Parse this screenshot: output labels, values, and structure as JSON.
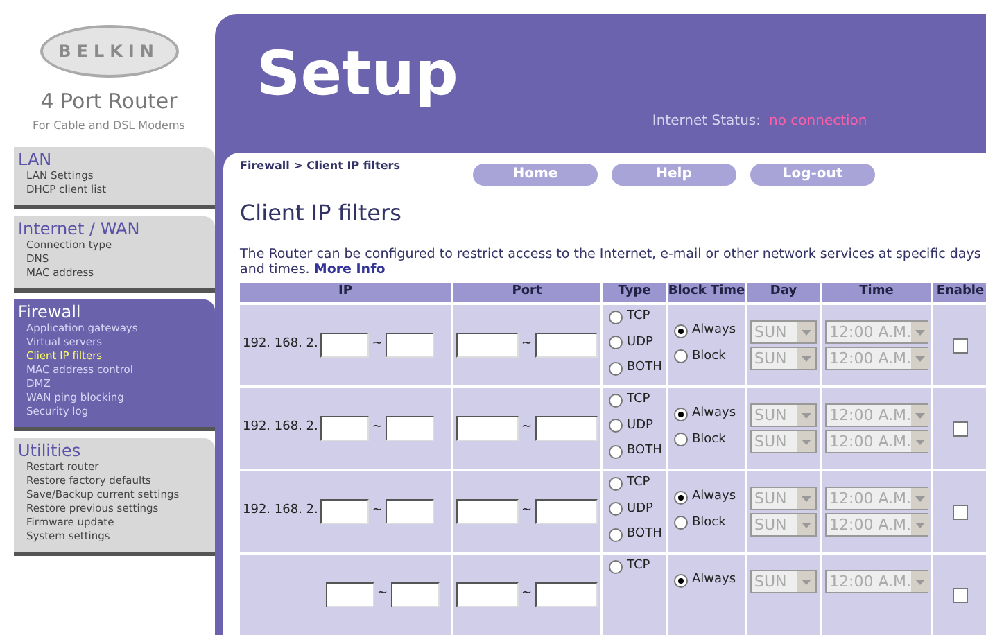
{
  "logo": {
    "brand": "BELKIN",
    "product": "4 Port Router",
    "tagline": "For Cable and DSL Modems"
  },
  "sidebar": {
    "sections": [
      {
        "title": "LAN",
        "selected": false,
        "items": [
          {
            "label": "LAN Settings",
            "selected": false
          },
          {
            "label": "DHCP client list",
            "selected": false
          }
        ]
      },
      {
        "title": "Internet / WAN",
        "selected": false,
        "items": [
          {
            "label": "Connection type",
            "selected": false
          },
          {
            "label": "DNS",
            "selected": false
          },
          {
            "label": "MAC address",
            "selected": false
          }
        ]
      },
      {
        "title": "Firewall",
        "selected": true,
        "items": [
          {
            "label": "Application gateways",
            "selected": false
          },
          {
            "label": "Virtual servers",
            "selected": false
          },
          {
            "label": "Client IP filters",
            "selected": true
          },
          {
            "label": "MAC address control",
            "selected": false
          },
          {
            "label": "DMZ",
            "selected": false
          },
          {
            "label": "WAN ping blocking",
            "selected": false
          },
          {
            "label": "Security log",
            "selected": false
          }
        ]
      },
      {
        "title": "Utilities",
        "selected": false,
        "items": [
          {
            "label": "Restart router",
            "selected": false
          },
          {
            "label": "Restore factory defaults",
            "selected": false
          },
          {
            "label": "Save/Backup current settings",
            "selected": false
          },
          {
            "label": "Restore previous settings",
            "selected": false
          },
          {
            "label": "Firmware update",
            "selected": false
          },
          {
            "label": "System settings",
            "selected": false
          }
        ]
      }
    ]
  },
  "header": {
    "title": "Setup",
    "status_label": "Internet Status:",
    "status_value": "no connection"
  },
  "breadcrumb": "Firewall > Client IP filters",
  "nav_buttons": [
    "Home",
    "Help",
    "Log-out"
  ],
  "page_title": "Client IP filters",
  "description": "The Router can be configured to restrict access to the Internet, e-mail or other network services at specific days and times.",
  "more_info_link": "More Info",
  "table": {
    "columns": [
      "IP",
      "Port",
      "Type",
      "Block Time",
      "Day",
      "Time",
      "Enable"
    ],
    "rows": [
      {
        "ip_prefix": "192. 168. 2.",
        "ip_separator": "~",
        "port_separator": "~",
        "types": [
          {
            "label": "TCP",
            "selected": false
          },
          {
            "label": "UDP",
            "selected": false
          },
          {
            "label": "BOTH",
            "selected": false
          }
        ],
        "block_times": [
          {
            "label": "Always",
            "selected": true
          },
          {
            "label": "Block",
            "selected": false
          }
        ],
        "schedules": [
          {
            "day": "SUN",
            "time": "12:00 A.M.",
            "disabled": true
          },
          {
            "day": "SUN",
            "time": "12:00 A.M.",
            "disabled": true
          }
        ],
        "enabled": false
      },
      {
        "ip_prefix": "192. 168. 2.",
        "ip_separator": "~",
        "port_separator": "~",
        "types": [
          {
            "label": "TCP",
            "selected": false
          },
          {
            "label": "UDP",
            "selected": false
          },
          {
            "label": "BOTH",
            "selected": false
          }
        ],
        "block_times": [
          {
            "label": "Always",
            "selected": true
          },
          {
            "label": "Block",
            "selected": false
          }
        ],
        "schedules": [
          {
            "day": "SUN",
            "time": "12:00 A.M.",
            "disabled": true
          },
          {
            "day": "SUN",
            "time": "12:00 A.M.",
            "disabled": true
          }
        ],
        "enabled": false
      },
      {
        "ip_prefix": "192. 168. 2.",
        "ip_separator": "~",
        "port_separator": "~",
        "types": [
          {
            "label": "TCP",
            "selected": false
          },
          {
            "label": "UDP",
            "selected": false
          },
          {
            "label": "BOTH",
            "selected": false
          }
        ],
        "block_times": [
          {
            "label": "Always",
            "selected": true
          },
          {
            "label": "Block",
            "selected": false
          }
        ],
        "schedules": [
          {
            "day": "SUN",
            "time": "12:00 A.M.",
            "disabled": true
          },
          {
            "day": "SUN",
            "time": "12:00 A.M.",
            "disabled": true
          }
        ],
        "enabled": false
      },
      {
        "ip_separator": "~",
        "port_separator": "~",
        "types": [
          {
            "label": "TCP",
            "selected": false
          }
        ],
        "block_times": [
          {
            "label": "Always",
            "selected": true
          }
        ],
        "schedules": [
          {
            "day": "SUN",
            "time": "12:00 A.M.",
            "disabled": true
          }
        ],
        "enabled": false
      }
    ]
  }
}
